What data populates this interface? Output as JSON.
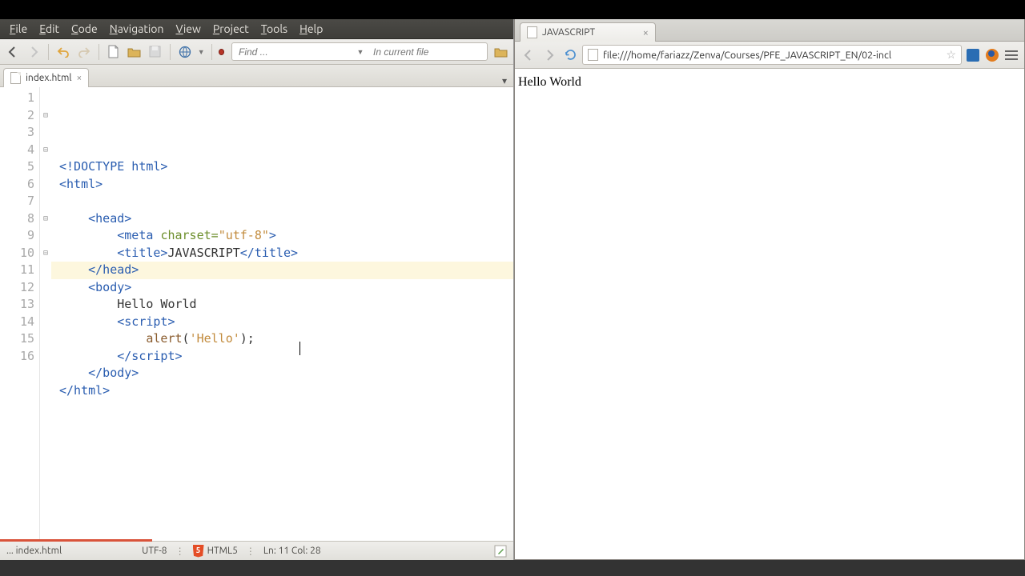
{
  "editor": {
    "menubar": [
      "File",
      "Edit",
      "Code",
      "Navigation",
      "View",
      "Project",
      "Tools",
      "Help"
    ],
    "find": {
      "placeholder": "Find ...",
      "scope": "In current file"
    },
    "tab": {
      "filename": "index.html"
    },
    "gutter_start": 1,
    "gutter_end": 16,
    "highlight_line": 11,
    "code": [
      {
        "indent": 0,
        "tokens": [
          {
            "t": "tag",
            "x": "<!DOCTYPE html>"
          }
        ]
      },
      {
        "indent": 0,
        "tokens": [
          {
            "t": "tag",
            "x": "<html>"
          }
        ],
        "fold": true
      },
      {
        "indent": 0,
        "tokens": []
      },
      {
        "indent": 1,
        "tokens": [
          {
            "t": "tag",
            "x": "<head>"
          }
        ],
        "fold": true
      },
      {
        "indent": 2,
        "tokens": [
          {
            "t": "tag",
            "x": "<meta "
          },
          {
            "t": "attr",
            "x": "charset="
          },
          {
            "t": "str",
            "x": "\"utf-8\""
          },
          {
            "t": "tag",
            "x": ">"
          }
        ]
      },
      {
        "indent": 2,
        "tokens": [
          {
            "t": "tag",
            "x": "<title>"
          },
          {
            "t": "plain",
            "x": "JAVASCRIPT"
          },
          {
            "t": "tag",
            "x": "</title>"
          }
        ]
      },
      {
        "indent": 1,
        "tokens": [
          {
            "t": "tag",
            "x": "</head>"
          }
        ]
      },
      {
        "indent": 1,
        "tokens": [
          {
            "t": "tag",
            "x": "<body>"
          }
        ],
        "fold": true
      },
      {
        "indent": 2,
        "tokens": [
          {
            "t": "plain",
            "x": "Hello World"
          }
        ]
      },
      {
        "indent": 2,
        "tokens": [
          {
            "t": "tag",
            "x": "<script>"
          }
        ],
        "fold": true
      },
      {
        "indent": 3,
        "tokens": [
          {
            "t": "id",
            "x": "alert"
          },
          {
            "t": "plain",
            "x": "("
          },
          {
            "t": "str",
            "x": "'Hello'"
          },
          {
            "t": "plain",
            "x": ");"
          }
        ]
      },
      {
        "indent": 2,
        "tokens": [
          {
            "t": "tag",
            "x": "</script>"
          }
        ]
      },
      {
        "indent": 1,
        "tokens": [
          {
            "t": "tag",
            "x": "</body>"
          }
        ]
      },
      {
        "indent": 0,
        "tokens": [
          {
            "t": "tag",
            "x": "</html>"
          }
        ]
      },
      {
        "indent": 0,
        "tokens": []
      },
      {
        "indent": 0,
        "tokens": []
      }
    ],
    "statusbar": {
      "file": "... index.html",
      "encoding": "UTF-8",
      "lang": "HTML5",
      "pos": "Ln: 11 Col: 28"
    }
  },
  "browser": {
    "tab_title": "JAVASCRIPT",
    "url": "file:///home/fariazz/Zenva/Courses/PFE_JAVASCRIPT_EN/02-incl",
    "content": "Hello World"
  }
}
